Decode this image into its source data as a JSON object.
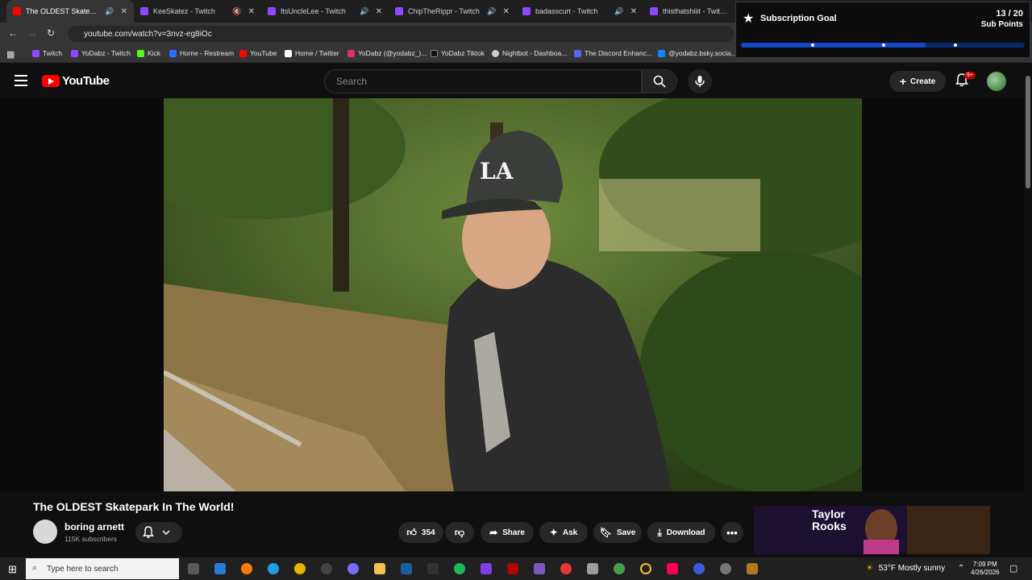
{
  "browser": {
    "tabs": [
      {
        "title": "The OLDEST Skatepark In The W",
        "active": true,
        "favicon_color": "#ff0000"
      },
      {
        "title": "KeeSkatez - Twitch",
        "active": false,
        "favicon_color": "#9146ff"
      },
      {
        "title": "ItsUncleLee - Twitch",
        "active": false,
        "favicon_color": "#9146ff"
      },
      {
        "title": "ChipTheRippr - Twitch",
        "active": false,
        "favicon_color": "#9146ff"
      },
      {
        "title": "badasscurt - Twitch",
        "active": false,
        "favicon_color": "#9146ff"
      },
      {
        "title": "thisthatshiiit - Twitch",
        "active": false,
        "favicon_color": "#9146ff"
      }
    ],
    "url": "youtube.com/watch?v=3nvz-eg8iOc",
    "bookmarks": [
      {
        "label": "Twitch",
        "color": "#9146ff"
      },
      {
        "label": "YoDabz - Twitch",
        "color": "#9146ff"
      },
      {
        "label": "Kick",
        "color": "#53fc18"
      },
      {
        "label": "Home - Restream",
        "color": "#2e6bff"
      },
      {
        "label": "YouTube",
        "color": "#ff0000"
      },
      {
        "label": "Home / Twitter",
        "color": "#ffffff"
      },
      {
        "label": "YoDabz (@yodabz_)...",
        "color": "#e1306c"
      },
      {
        "label": "YoDabz Tiktok",
        "color": "#111111"
      },
      {
        "label": "Nightbot - Dashboa...",
        "color": "#cccccc"
      },
      {
        "label": "The Discord Enhanc...",
        "color": "#5865f2"
      },
      {
        "label": "@yodabz.bsky.socia...",
        "color": "#1185fe"
      }
    ]
  },
  "subscription_goal": {
    "title": "Subscription Goal",
    "count": "13 / 20",
    "unit": "Sub Points",
    "progress": 0.65,
    "milestones": [
      0.25,
      0.5,
      0.75
    ]
  },
  "youtube": {
    "logo": "YouTube",
    "search_placeholder": "Search",
    "create_label": "Create",
    "notif_badge": "9+"
  },
  "video": {
    "title": "The OLDEST Skatepark In The World!",
    "channel": "boring arnett",
    "subscribers": "115K subscribers",
    "likes": "354",
    "share_label": "Share",
    "ask_label": "Ask",
    "save_label": "Save",
    "download_label": "Download"
  },
  "promo": {
    "line1": "Taylor",
    "line2": "Rooks"
  },
  "taskbar": {
    "search_placeholder": "Type here to search",
    "weather": "53°F  Mostly sunny",
    "time": "7:09 PM",
    "date": "4/26/2026"
  }
}
